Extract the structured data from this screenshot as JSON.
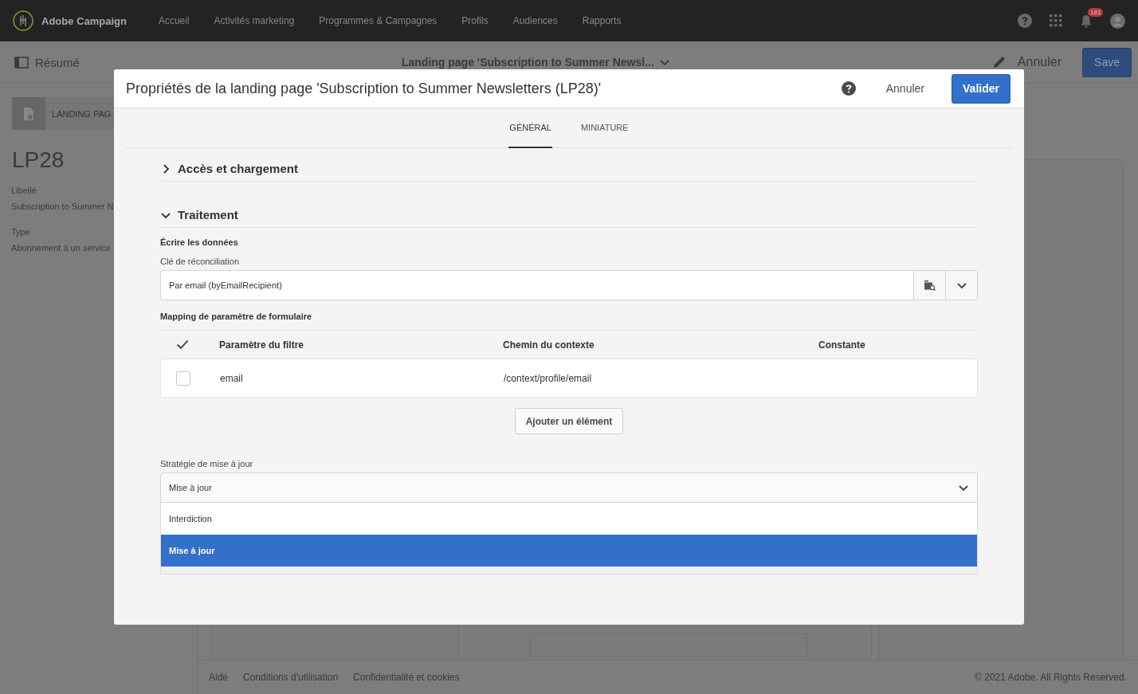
{
  "app_bar": {
    "brand": "Adobe Campaign",
    "nav": [
      "Accueil",
      "Activités marketing",
      "Programmes & Campagnes",
      "Profils",
      "Audiences",
      "Rapports"
    ],
    "notification_count": "181"
  },
  "page_header": {
    "summary_label": "Résumé",
    "title": "Landing page 'Subscription to Summer Newsl...",
    "cancel": "Annuler",
    "save": "Save"
  },
  "left_panel": {
    "card_label": "LANDING PAG",
    "id": "LP28",
    "fields": [
      {
        "label": "Libellé",
        "value": "Subscription to Summer N"
      },
      {
        "label": "Type",
        "value": "Abonnement à un service"
      }
    ]
  },
  "dialog": {
    "title": "Propriétés de la landing page 'Subscription to Summer Newsletters (LP28)'",
    "cancel": "Annuler",
    "confirm": "Valider",
    "tabs": [
      {
        "label": "GÉNÉRAL",
        "selected": true
      },
      {
        "label": "MINIATURE",
        "selected": false
      }
    ],
    "sections": [
      {
        "title": "Accès et chargement",
        "expanded": false
      },
      {
        "title": "Traitement",
        "expanded": true,
        "body": {
          "heading": "Écrire les données",
          "reconciliation_label": "Clé de réconciliation",
          "reconciliation_value": "Par email (byEmailRecipient)",
          "mapping_label": "Mapping de paramètre de formulaire",
          "mapping_columns": [
            "Paramètre du filtre",
            "Chemin du contexte",
            "Constante"
          ],
          "mapping_rows": [
            {
              "checked": false,
              "parameter": "email",
              "context_path": "/context/profile/email"
            }
          ],
          "add_button": "Ajouter un élément",
          "strategy_label": "Stratégie de mise à jour",
          "strategy_value": "Mise à jour",
          "strategy_options": [
            {
              "label": "Interdiction",
              "selected": false
            },
            {
              "label": "Mise à jour",
              "selected": true
            }
          ]
        }
      }
    ]
  },
  "footer": {
    "links": [
      "Aide",
      "Conditions d'utilisation",
      "Confidentialité et cookies"
    ],
    "copyright": "© 2021 Adobe. All Rights Reserved."
  }
}
